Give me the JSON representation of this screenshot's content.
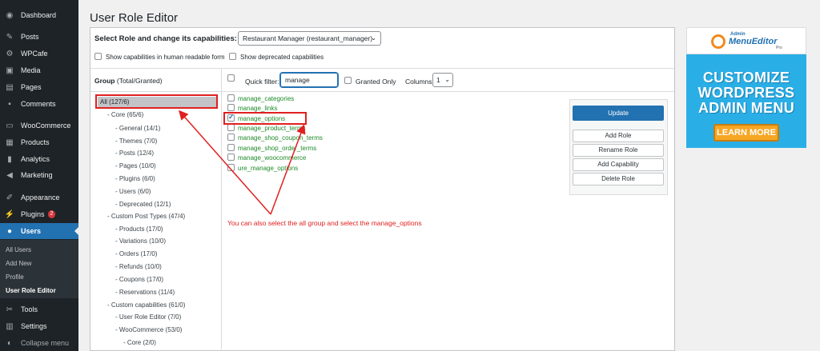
{
  "sidebar": {
    "items": [
      {
        "label": "Dashboard",
        "icon": "dashboard-icon"
      },
      {
        "label": "Posts",
        "icon": "pin-icon"
      },
      {
        "label": "WPCafe",
        "icon": "gear-icon"
      },
      {
        "label": "Media",
        "icon": "media-icon"
      },
      {
        "label": "Pages",
        "icon": "pages-icon"
      },
      {
        "label": "Comments",
        "icon": "comment-icon"
      },
      {
        "label": "WooCommerce",
        "icon": "woo-icon"
      },
      {
        "label": "Products",
        "icon": "archive-icon"
      },
      {
        "label": "Analytics",
        "icon": "chart-icon"
      },
      {
        "label": "Marketing",
        "icon": "megaphone-icon"
      },
      {
        "label": "Appearance",
        "icon": "brush-icon"
      },
      {
        "label": "Plugins",
        "icon": "plug-icon",
        "badge": "2"
      },
      {
        "label": "Users",
        "icon": "user-icon"
      },
      {
        "label": "Tools",
        "icon": "wrench-icon"
      },
      {
        "label": "Settings",
        "icon": "settings-icon"
      },
      {
        "label": "Collapse menu",
        "icon": "collapse-icon"
      }
    ],
    "submenu": [
      "All Users",
      "Add New",
      "Profile",
      "User Role Editor"
    ],
    "active_color": "#2271b1"
  },
  "page": {
    "title": "User Role Editor",
    "select_label": "Select Role and change its capabilities:",
    "role_value": "Restaurant Manager (restaurant_manager)",
    "opt_human": "Show capabilities in human readable form",
    "opt_deprecated": "Show deprecated capabilities"
  },
  "groups": {
    "header_bold": "Group",
    "header_rest": "(Total/Granted)",
    "all": "All (127/6)",
    "items": [
      "- Core (65/6)",
      "- General (14/1)",
      "- Themes (7/0)",
      "- Posts (12/4)",
      "- Pages (10/0)",
      "- Plugins (6/0)",
      "- Users (6/0)",
      "- Deprecated (12/1)",
      "- Custom Post Types (47/4)",
      "- Products (17/0)",
      "- Variations (10/0)",
      "- Orders (17/0)",
      "- Refunds (10/0)",
      "- Coupons (17/0)",
      "- Reservations (11/4)",
      "- Custom capabilities (61/0)",
      "- User Role Editor (7/0)",
      "- WooCommerce (53/0)",
      "- Core (2/0)"
    ]
  },
  "filter": {
    "label": "Quick filter:",
    "value": "manage",
    "granted_only": "Granted Only",
    "columns_label": "Columns:",
    "columns_value": "1"
  },
  "capabilities": [
    {
      "name": "manage_categories",
      "checked": false
    },
    {
      "name": "manage_links",
      "checked": false
    },
    {
      "name": "manage_options",
      "checked": true
    },
    {
      "name": "manage_product_terms",
      "checked": false
    },
    {
      "name": "manage_shop_coupon_terms",
      "checked": false
    },
    {
      "name": "manage_shop_order_terms",
      "checked": false
    },
    {
      "name": "manage_woocommerce",
      "checked": false
    },
    {
      "name": "ure_manage_options",
      "checked": false
    }
  ],
  "buttons": {
    "update": "Update",
    "add_role": "Add Role",
    "rename_role": "Rename Role",
    "add_capability": "Add Capability",
    "delete_role": "Delete Role"
  },
  "annotation": "You can also select the all group and select the manage_options",
  "ad": {
    "logo_small": "Admin",
    "logo_text": "MenuEditor",
    "logo_pro": "Pro",
    "headline": [
      "CUSTOMIZE",
      "WORDPRESS",
      "ADMIN MENU"
    ],
    "button": "LEARN MORE"
  }
}
